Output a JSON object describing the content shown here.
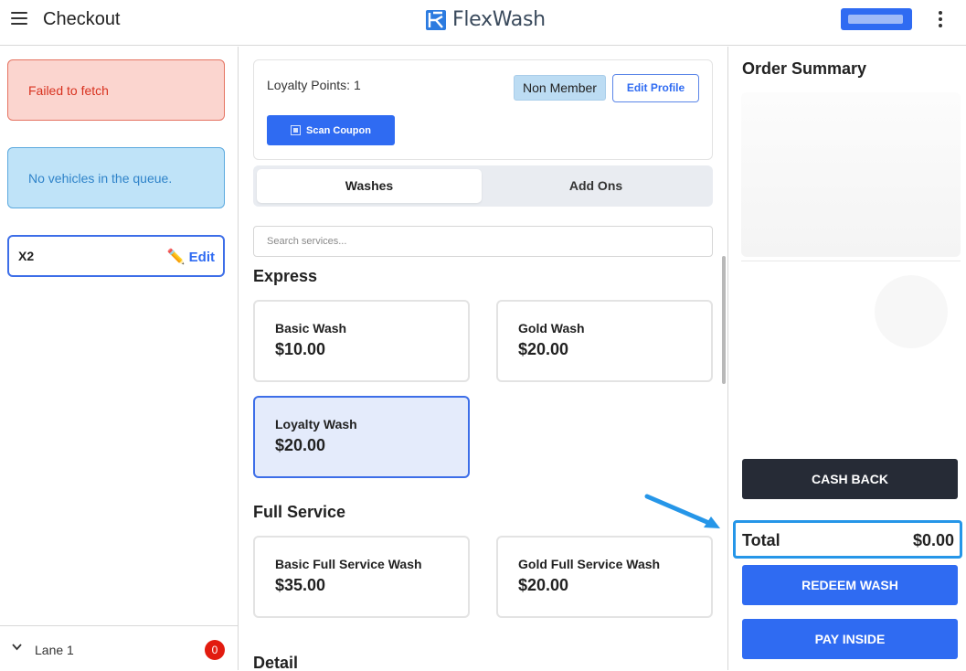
{
  "header": {
    "title": "Checkout",
    "logo_text": "FlexWash"
  },
  "left": {
    "alert_error": "Failed to fetch",
    "alert_info": "No vehicles in the queue.",
    "vehicle": {
      "plate": "X2",
      "edit_label": "Edit"
    },
    "lane": {
      "label": "Lane 1",
      "badge_count": "0"
    }
  },
  "profile": {
    "loyalty_points": "Loyalty Points: 1",
    "member_status": "Non Member",
    "edit_profile_label": "Edit Profile",
    "scan_coupon_label": "Scan Coupon"
  },
  "tabs": [
    {
      "label": "Washes",
      "active": true
    },
    {
      "label": "Add Ons",
      "active": false
    }
  ],
  "search": {
    "placeholder": "Search services..."
  },
  "sections": [
    {
      "title": "Express",
      "services": [
        {
          "name": "Basic Wash",
          "price": "$10.00",
          "selected": false
        },
        {
          "name": "Gold Wash",
          "price": "$20.00",
          "selected": false
        },
        {
          "name": "Loyalty Wash",
          "price": "$20.00",
          "selected": true
        }
      ]
    },
    {
      "title": "Full Service",
      "services": [
        {
          "name": "Basic Full Service Wash",
          "price": "$35.00",
          "selected": false
        },
        {
          "name": "Gold Full Service Wash",
          "price": "$20.00",
          "selected": false
        }
      ]
    },
    {
      "title": "Detail",
      "services": []
    }
  ],
  "order_summary": {
    "title": "Order Summary",
    "cash_back_label": "CASH BACK",
    "total_label": "Total",
    "total_value": "$0.00",
    "redeem_label": "REDEEM WASH",
    "pay_label": "PAY INSIDE"
  },
  "colors": {
    "primary": "#2f6bf2",
    "dark_button": "#262b36",
    "error_bg": "#fbd5cf",
    "info_bg": "#bfe3f8",
    "highlight": "#2696e8",
    "selected_card": "#e4ebfb"
  }
}
